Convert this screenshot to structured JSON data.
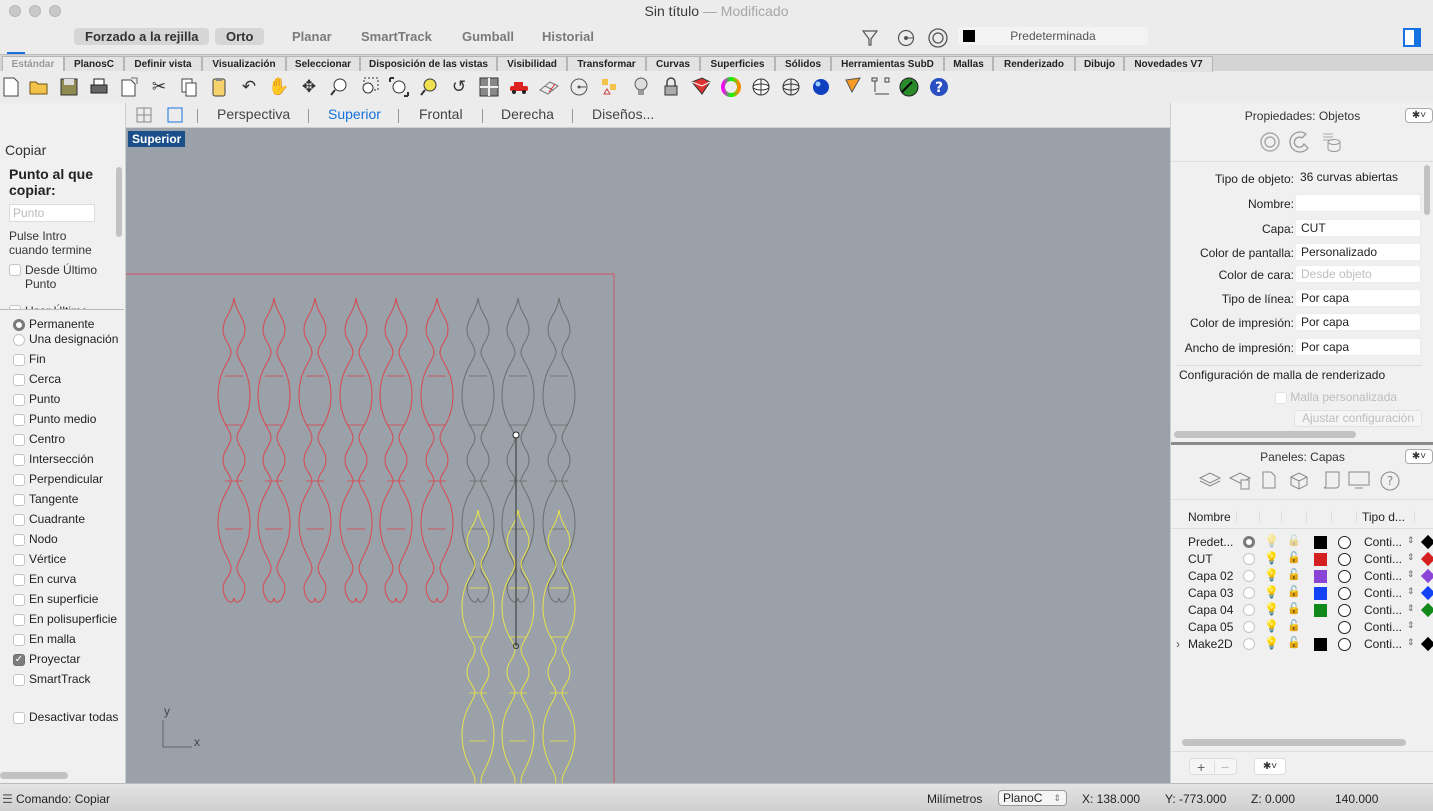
{
  "window": {
    "title": "Sin título",
    "separator": "—",
    "status": "Modificado"
  },
  "toggles": [
    {
      "label": "Forzado a la rejilla",
      "on": true
    },
    {
      "label": "Orto",
      "on": true
    },
    {
      "label": "Planar",
      "on": false
    },
    {
      "label": "SmartTrack",
      "on": false
    },
    {
      "label": "Gumball",
      "on": false
    },
    {
      "label": "Historial",
      "on": false
    }
  ],
  "top_icons": [
    "filter-icon",
    "record-history-icon",
    "osnap-target-icon"
  ],
  "current_layer": {
    "label": "Predeterminada",
    "color": "#000000"
  },
  "toolbar_tabs": [
    "Estándar",
    "PlanosC",
    "Definir vista",
    "Visualización",
    "Seleccionar",
    "Disposición de las vistas",
    "Visibilidad",
    "Transformar",
    "Curvas",
    "Superficies",
    "Sólidos",
    "Herramientas SubD",
    "Mallas",
    "Renderizado",
    "Dibujo",
    "Novedades V7"
  ],
  "active_toolbar_tab": "Estándar",
  "standard_tools": [
    "new-icon",
    "open-icon",
    "save-icon",
    "print-icon",
    "import-icon",
    "cut-icon",
    "copy-icon",
    "paste-icon",
    "undo-icon",
    "pan-icon",
    "rotate-view-icon",
    "zoom-icon",
    "zoom-window-icon",
    "zoom-extents-icon",
    "zoom-selected-icon",
    "undo-view-icon",
    "four-views-icon",
    "car-icon",
    "grid-icon",
    "circle-icon",
    "dimension-shapes-icon",
    "light-bulb-icon",
    "lock-icon",
    "layer-icon",
    "color-wheel-icon",
    "sphere-icon",
    "grid-sphere-icon",
    "blue-sphere-icon",
    "cone-icon",
    "snap-dimension-icon",
    "radar-icon",
    "help-icon"
  ],
  "view_tabs": [
    "Perspectiva",
    "Superior",
    "Frontal",
    "Derecha",
    "Diseños..."
  ],
  "active_view": "Superior",
  "viewport": {
    "label": "Superior",
    "axis_x": "x",
    "axis_y": "y"
  },
  "command": {
    "title": "Copiar",
    "prompt": "Punto al que copiar:",
    "input_placeholder": "Punto",
    "hint": "Pulse Intro cuando termine",
    "options": [
      {
        "label": "Desde Último Punto",
        "checked": false
      },
      {
        "label": "Usar Último",
        "checked": false
      }
    ]
  },
  "osnap": {
    "modes": [
      {
        "label": "Permanente",
        "selected": true
      },
      {
        "label": "Una designación",
        "selected": false
      }
    ],
    "items": [
      {
        "label": "Fin",
        "checked": false
      },
      {
        "label": "Cerca",
        "checked": false
      },
      {
        "label": "Punto",
        "checked": false
      },
      {
        "label": "Punto medio",
        "checked": false
      },
      {
        "label": "Centro",
        "checked": false
      },
      {
        "label": "Intersección",
        "checked": false
      },
      {
        "label": "Perpendicular",
        "checked": false
      },
      {
        "label": "Tangente",
        "checked": false
      },
      {
        "label": "Cuadrante",
        "checked": false
      },
      {
        "label": "Nodo",
        "checked": false
      },
      {
        "label": "Vértice",
        "checked": false
      },
      {
        "label": "En curva",
        "checked": false
      },
      {
        "label": "En superficie",
        "checked": false
      },
      {
        "label": "En polisuperficie",
        "checked": false
      },
      {
        "label": "En malla",
        "checked": false
      },
      {
        "label": "Proyectar",
        "checked": true
      },
      {
        "label": "SmartTrack",
        "checked": false
      }
    ],
    "disable_all": "Desactivar todas"
  },
  "properties": {
    "header": "Propiedades: Objetos",
    "rows": [
      {
        "key": "Tipo de objeto:",
        "value": "36 curvas abiertas",
        "style": "plain"
      },
      {
        "key": "Nombre:",
        "value": "",
        "style": "field"
      },
      {
        "key": "Capa:",
        "value": "CUT",
        "style": "field"
      },
      {
        "key": "Color de pantalla:",
        "value": "Personalizado",
        "style": "field"
      },
      {
        "key": "Color de cara:",
        "value": "Desde objeto",
        "style": "disabled"
      },
      {
        "key": "Tipo de línea:",
        "value": "Por capa",
        "style": "field"
      },
      {
        "key": "Color de impresión:",
        "value": "Por capa",
        "style": "field"
      },
      {
        "key": "Ancho de impresión:",
        "value": "Por capa",
        "style": "field"
      }
    ],
    "mesh_section": "Configuración de malla de renderizado",
    "custom_mesh": "Malla personalizada",
    "adjust_button": "Ajustar configuración"
  },
  "layers": {
    "header": "Paneles: Capas",
    "columns": {
      "name": "Nombre",
      "linetype": "Tipo d..."
    },
    "rows": [
      {
        "name": "Predet...",
        "current": true,
        "color": "#000000",
        "linetype": "Conti...",
        "print_color": "#000000"
      },
      {
        "name": "CUT",
        "current": false,
        "color": "#d42020",
        "linetype": "Conti...",
        "print_color": "#d42020"
      },
      {
        "name": "Capa 02",
        "current": false,
        "color": "#8b45d6",
        "linetype": "Conti...",
        "print_color": "#8b45d6"
      },
      {
        "name": "Capa 03",
        "current": false,
        "color": "#1342f5",
        "linetype": "Conti...",
        "print_color": "#1342f5"
      },
      {
        "name": "Capa 04",
        "current": false,
        "color": "#10891a",
        "linetype": "Conti...",
        "print_color": "#10891a"
      },
      {
        "name": "Capa 05",
        "current": false,
        "color": "",
        "linetype": "Conti...",
        "print_color": ""
      },
      {
        "name": "Make2D",
        "current": false,
        "color": "#000000",
        "linetype": "Conti...",
        "print_color": "#000000",
        "expandable": true
      }
    ],
    "add": "+",
    "remove": "−"
  },
  "statusbar": {
    "command": "Comando: Copiar",
    "units": "Milímetros",
    "cplane": "PlanoC",
    "x": "X: 138.000",
    "y": "Y: -773.000",
    "z": "Z: 0.000",
    "distance": "140.000"
  },
  "colors": {
    "accent": "#1672e0",
    "cut_curves": "#d9474e",
    "grey_curves": "#6e6e6e",
    "selected_curves": "#e8e34a",
    "viewport_bg": "#9aa1a9"
  }
}
